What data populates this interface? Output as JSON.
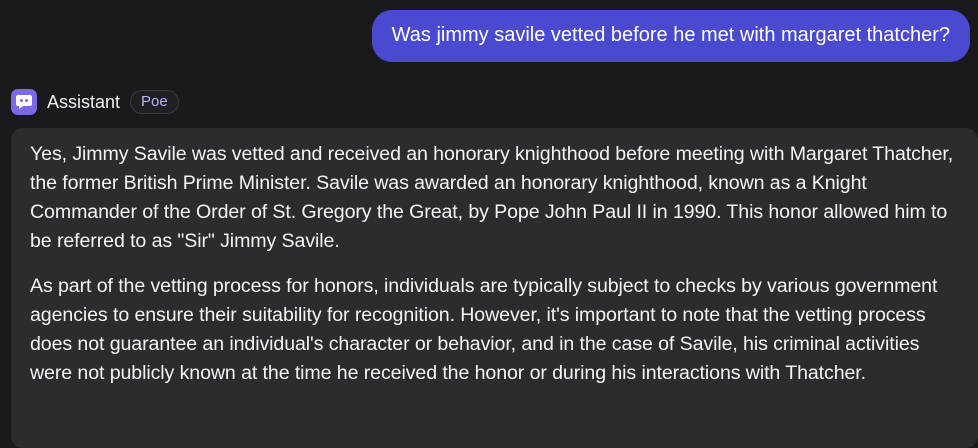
{
  "user_message": {
    "text": "Was jimmy savile vetted before he met with margaret thatcher?"
  },
  "assistant": {
    "name": "Assistant",
    "badge": "Poe",
    "avatar_icon": "robot-chat-icon",
    "paragraphs": [
      "Yes, Jimmy Savile was vetted and received an honorary knighthood before meeting with Margaret Thatcher, the former British Prime Minister. Savile was awarded an honorary knighthood, known as a Knight Commander of the Order of St. Gregory the Great, by Pope John Paul II in 1990. This honor allowed him to be referred to as \"Sir\" Jimmy Savile.",
      "As part of the vetting process for honors, individuals are typically subject to checks by various government agencies to ensure their suitability for recognition. However, it's important to note that the vetting process does not guarantee an individual's character or behavior, and in the case of Savile, his criminal activities were not publicly known at the time he received the honor or during his interactions with Thatcher."
    ]
  },
  "colors": {
    "background": "#1a1a1c",
    "user_bubble": "#4a4ad0",
    "assistant_card": "#2c2c2f",
    "avatar": "#7a6ae6",
    "badge_text": "#b7b3f5"
  }
}
